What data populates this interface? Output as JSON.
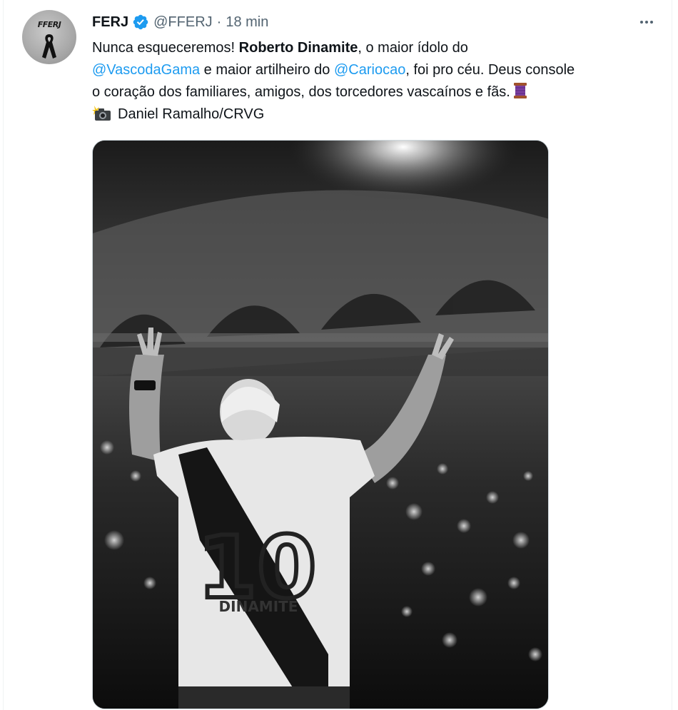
{
  "tweet": {
    "author_name": "FERJ",
    "handle": "@FFERJ",
    "separator": "·",
    "time": "18 min",
    "avatar_logo_text": "FFERJ",
    "text": {
      "line1_a": "Nunca esqueceremos! ",
      "line1_bold": "Roberto Dinamite",
      "line1_b": ", o maior ídolo do",
      "line2_mention1": "@VascodaGama",
      "line2_a": " e maior artilheiro do ",
      "line2_mention2": "@Cariocao",
      "line2_b": ", foi pro céu. Deus console",
      "line3": "o coração dos familiares, amigos, dos torcedores vascaínos e fãs.",
      "line4": "Daniel Ramalho/CRVG"
    },
    "photo": {
      "jersey_number": "10",
      "jersey_name": "DINAMITE"
    }
  },
  "icons": {
    "verified": "verified-badge-icon",
    "more": "more-options-icon",
    "spool": "spool-of-thread-emoji",
    "camera": "camera-flash-emoji",
    "ribbon": "black-mourning-ribbon-icon"
  },
  "colors": {
    "accent": "#1d9bf0",
    "text_primary": "#0f1419",
    "text_secondary": "#536471"
  }
}
